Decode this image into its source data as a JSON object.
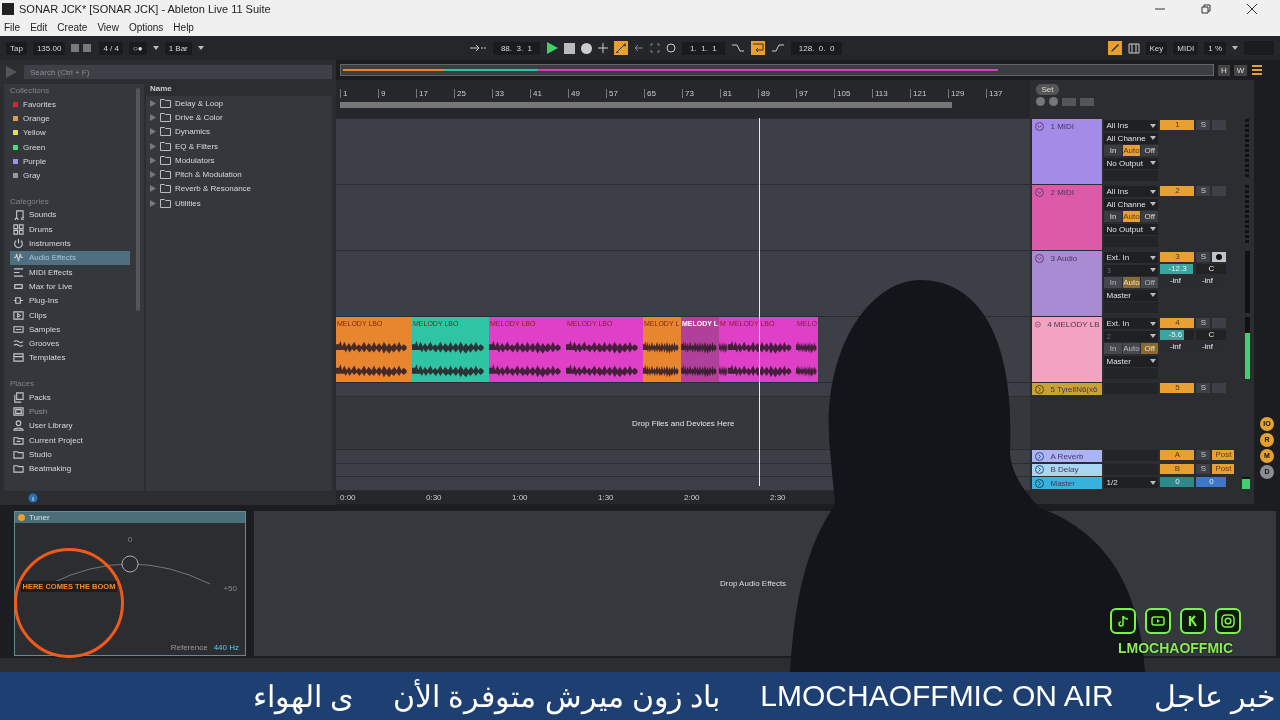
{
  "window": {
    "title": "SONAR JCK*  [SONAR JCK] - Ableton Live 11 Suite"
  },
  "menu": [
    "File",
    "Edit",
    "Create",
    "View",
    "Options",
    "Help"
  ],
  "toolbar": {
    "tap": "Tap",
    "tempo": "135.00",
    "signature": "4 / 4",
    "metronome": "○●",
    "quantize": "1 Bar",
    "position": "88.  3.  1",
    "playing": true,
    "automation_arm": true,
    "loop_start": "1.  1.  1",
    "loop": true,
    "loop_length": "128.  0.  0",
    "draw_mode": true,
    "key": "Key",
    "midi": "MIDI",
    "cpu": "1 %"
  },
  "overview": {
    "buttons": [
      "H",
      "W"
    ]
  },
  "browser": {
    "search": {
      "placeholder": "Search (Ctrl + F)"
    },
    "collections_title": "Collections",
    "collections": [
      {
        "label": "Favorites",
        "color": "#e0202a"
      },
      {
        "label": "Orange",
        "color": "#e89a3c"
      },
      {
        "label": "Yellow",
        "color": "#e6e04a"
      },
      {
        "label": "Green",
        "color": "#3ee07a"
      },
      {
        "label": "Purple",
        "color": "#a58cf0"
      },
      {
        "label": "Gray",
        "color": "#9a9a9a"
      }
    ],
    "categories_title": "Categories",
    "categories": [
      {
        "label": "Sounds",
        "kind": "sounds",
        "selected": false
      },
      {
        "label": "Drums",
        "kind": "drums",
        "selected": false
      },
      {
        "label": "Instruments",
        "kind": "instruments",
        "selected": false
      },
      {
        "label": "Audio Effects",
        "kind": "audio-effects",
        "selected": true
      },
      {
        "label": "MIDI Effects",
        "kind": "midi-effects",
        "selected": false
      },
      {
        "label": "Max for Live",
        "kind": "max",
        "selected": false
      },
      {
        "label": "Plug-Ins",
        "kind": "plugins",
        "selected": false
      },
      {
        "label": "Clips",
        "kind": "clips",
        "selected": false
      },
      {
        "label": "Samples",
        "kind": "samples",
        "selected": false
      },
      {
        "label": "Grooves",
        "kind": "grooves",
        "selected": false
      },
      {
        "label": "Templates",
        "kind": "templates",
        "selected": false
      }
    ],
    "places_title": "Places",
    "places": [
      {
        "label": "Packs",
        "kind": "packs",
        "disabled": false
      },
      {
        "label": "Push",
        "kind": "push",
        "disabled": true
      },
      {
        "label": "User Library",
        "kind": "user",
        "disabled": false
      },
      {
        "label": "Current Project",
        "kind": "project",
        "disabled": false
      },
      {
        "label": "Studio",
        "kind": "folder",
        "disabled": false
      },
      {
        "label": "Beatmaking",
        "kind": "folder",
        "disabled": false
      }
    ],
    "column": "Name",
    "folders": [
      "Delay & Loop",
      "Drive & Color",
      "Dynamics",
      "EQ & Filters",
      "Modulators",
      "Pitch & Modulation",
      "Reverb & Resonance",
      "Utilities"
    ]
  },
  "ruler": [
    "1",
    "9",
    "17",
    "25",
    "33",
    "41",
    "49",
    "57",
    "65",
    "73",
    "81",
    "89",
    "97",
    "105",
    "113",
    "121",
    "129",
    "137"
  ],
  "mixer": {
    "set": "Set"
  },
  "tracks": [
    {
      "name": "1 MIDI",
      "kind": "midi",
      "color": "#a58be8",
      "input": "All Ins",
      "channel": "All Channe",
      "monitor_dimmed": false,
      "monitor": [
        {
          "label": "In",
          "selected": false
        },
        {
          "label": "Auto",
          "selected": true
        },
        {
          "label": "Off",
          "selected": false
        }
      ],
      "output": "No Output",
      "number": "1",
      "solo": "S",
      "armed": false
    },
    {
      "name": "2 MIDI",
      "kind": "midi",
      "color": "#dc5aa8",
      "input": "All Ins",
      "channel": "All Channe",
      "monitor_dimmed": false,
      "monitor": [
        {
          "label": "In",
          "selected": false
        },
        {
          "label": "Auto",
          "selected": true
        },
        {
          "label": "Off",
          "selected": false
        }
      ],
      "output": "No Output",
      "number": "2",
      "solo": "S",
      "armed": false
    },
    {
      "name": "3 Audio",
      "kind": "audio",
      "color": "#a98bd4",
      "input": "Ext. In",
      "channel": "3",
      "monitor_dimmed": true,
      "monitor": [
        {
          "label": "In",
          "selected": false
        },
        {
          "label": "Auto",
          "selected": true
        },
        {
          "label": "Off",
          "selected": false
        }
      ],
      "output": "Master",
      "number": "3",
      "solo": "S",
      "armed": true,
      "volume": {
        "value": "-12.3",
        "level": 0.95
      },
      "pan": "C",
      "sends": [
        "-inf",
        "-inf"
      ],
      "meter": {
        "level": 0
      }
    },
    {
      "name": "4 MELODY LB",
      "kind": "audio",
      "color": "#f2a3bf",
      "input": "Ext. In",
      "channel": "2",
      "monitor_dimmed": true,
      "monitor": [
        {
          "label": "In",
          "selected": false
        },
        {
          "label": "Auto",
          "selected": false
        },
        {
          "label": "Off",
          "selected": true
        }
      ],
      "output": "Master",
      "number": "4",
      "solo": "S",
      "armed": false,
      "volume": {
        "value": "-5.6",
        "level": 0.7
      },
      "pan": "C",
      "sends": [
        "-inf",
        "-inf"
      ],
      "meter": {
        "level": 0.75
      },
      "clips": [
        {
          "label": "MELODY LBO",
          "color": "#e8862f",
          "selected": false
        },
        {
          "label": "MELODY LBO",
          "color": "#2ec4a4",
          "selected": false
        },
        {
          "label": "MELODY LBO",
          "color": "#e040c8",
          "selected": false
        },
        {
          "label": "MELODY LBO",
          "color": "#e040c8",
          "selected": false
        },
        {
          "label": "MELODY L",
          "color": "#e8862f",
          "selected": false
        },
        {
          "label": "MELODY L",
          "color": "#b0409a",
          "selected": true
        },
        {
          "label": "M",
          "color": "#e040c8",
          "selected": false
        },
        {
          "label": "MELODY LBO",
          "color": "#e040c8",
          "selected": false
        },
        {
          "label": "MELO",
          "color": "#e040c8",
          "selected": false
        }
      ]
    },
    {
      "name": "5 TyrellN6(x6",
      "kind": "folded",
      "color": "#c8a232",
      "number": "5",
      "solo": "S"
    },
    {
      "kind": "drop",
      "label": "Drop Files and Devices Here"
    },
    {
      "name": "A Reverb",
      "kind": "return",
      "color": "#aab4f6",
      "number": "A",
      "solo": "S",
      "post": "Post"
    },
    {
      "name": "B Delay",
      "kind": "return",
      "color": "#a8d6f2",
      "number": "B",
      "solo": "S",
      "post": "Post"
    },
    {
      "name": "Master",
      "kind": "master",
      "color": "#38b2dc",
      "output": "1/2",
      "volume": "0",
      "pan": "0",
      "meter": {
        "level": 0.8
      }
    }
  ],
  "time_ruler": [
    "0:00",
    "0:30",
    "1:00",
    "1:30",
    "2:00",
    "2:30"
  ],
  "view_toggles": [
    {
      "label": "IO",
      "selected": true
    },
    {
      "label": "R",
      "selected": true
    },
    {
      "label": "M",
      "selected": true
    },
    {
      "label": "D",
      "selected": false
    }
  ],
  "device": {
    "title": "Tuner",
    "on": true,
    "scale_center": "0",
    "scale_right": "+50",
    "reference_label": "Reference",
    "reference": "440 Hz",
    "drop_hint": "Drop Audio Effects"
  },
  "overlay": {
    "logo_text": "HERE COMES THE BOOM",
    "channel": "LMOCHAOFFMIC"
  },
  "ticker": [
    "خبر عاجل",
    "LMOCHAOFFMIC ON AIR",
    "باد زون ميرش متوفرة الأن",
    "ى الهواء"
  ]
}
